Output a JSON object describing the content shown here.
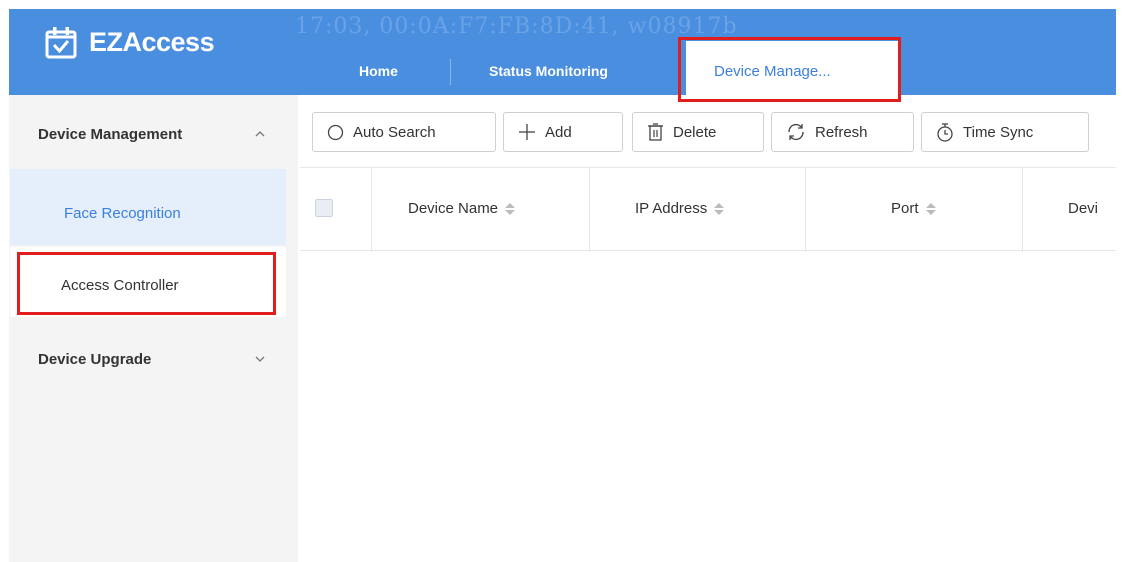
{
  "app": {
    "name": "EZAccess",
    "watermark": "17:03, 00:0A:F7:FB:8D:41, w08917b"
  },
  "nav": {
    "tabs": [
      {
        "label": "Home"
      },
      {
        "label": "Status Monitoring"
      },
      {
        "label": "Device Manage..."
      }
    ],
    "active": "Device Manage...",
    "active_color": "#3b7fe0"
  },
  "header": {
    "color": "#4a8ee0"
  },
  "highlight": {
    "color": "#e11d1d"
  },
  "sidebar": {
    "groups": [
      {
        "label": "Device Management",
        "expanded": true,
        "icon": "chevron-up-icon",
        "items": [
          {
            "label": "Face Recognition",
            "selected": true
          },
          {
            "label": "Access Controller",
            "selected": false
          }
        ]
      },
      {
        "label": "Device Upgrade",
        "expanded": false,
        "icon": "chevron-down-icon"
      }
    ]
  },
  "toolbar": {
    "auto_search": "Auto Search",
    "add": "Add",
    "delete": "Delete",
    "refresh": "Refresh",
    "time_sync": "Time Sync"
  },
  "table": {
    "columns": [
      {
        "label": "Device Name"
      },
      {
        "label": "IP Address"
      },
      {
        "label": "Port"
      },
      {
        "label": "Devi"
      }
    ],
    "rows": []
  }
}
